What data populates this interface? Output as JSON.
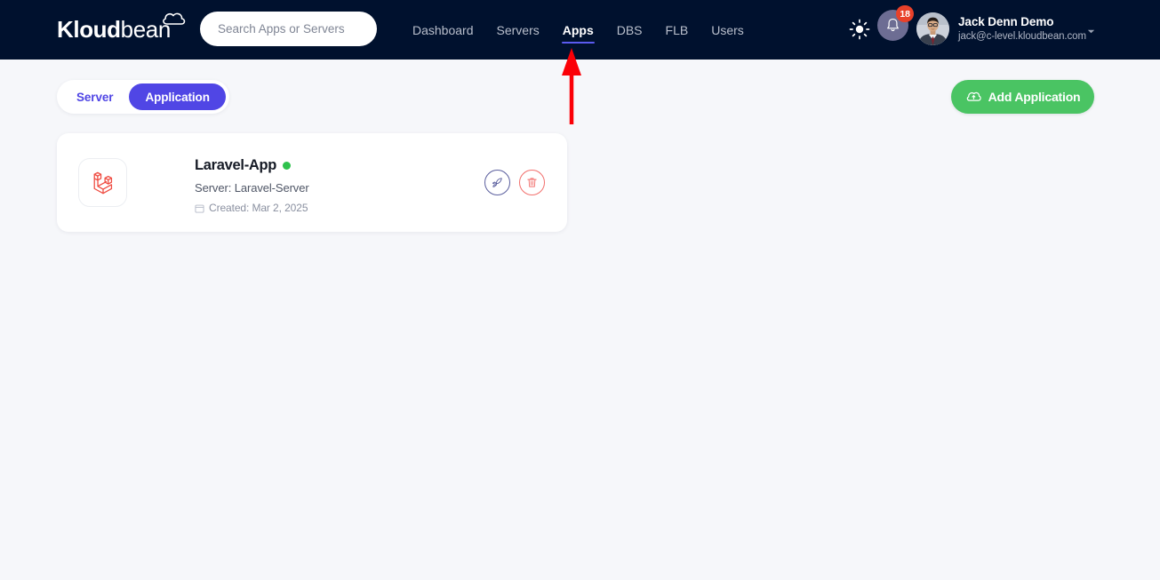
{
  "header": {
    "logo": {
      "bold": "Kloud",
      "light": "bean",
      "cloud_icon": "cloud-icon"
    },
    "search": {
      "placeholder": "Search Apps or Servers",
      "value": "",
      "icon": "search-input"
    },
    "nav": [
      {
        "label": "Dashboard",
        "active": false
      },
      {
        "label": "Servers",
        "active": false
      },
      {
        "label": "Apps",
        "active": true
      },
      {
        "label": "DBS",
        "active": false
      },
      {
        "label": "FLB",
        "active": false
      },
      {
        "label": "Users",
        "active": false
      }
    ],
    "theme_toggle_icon": "sun-icon",
    "notifications": {
      "icon": "bell-icon",
      "count": "18",
      "badge_color": "#e8412a",
      "circle_color": "#6d6d93"
    },
    "user": {
      "avatar_icon": "user-avatar",
      "name": "Jack Denn Demo",
      "email": "jack@c-level.kloudbean.com",
      "caret_icon": "chevron-down-icon"
    },
    "background_color": "#00112e",
    "active_underline_color": "#5b5bf0"
  },
  "controls": {
    "toggle": {
      "options": [
        {
          "label": "Server",
          "active": false
        },
        {
          "label": "Application",
          "active": true
        }
      ],
      "active_color": "#5046e5"
    },
    "add_application": {
      "label": "Add Application",
      "icon": "cloud-upload-icon",
      "color": "#4ac463"
    }
  },
  "applications": [
    {
      "icon": "laravel-icon",
      "name": "Laravel-App",
      "status": "online",
      "status_color": "#2fc24d",
      "server_label": "Server: Laravel-Server",
      "created_icon": "calendar-icon",
      "created_label": "Created: Mar 2, 2025",
      "actions": [
        {
          "name": "deploy-button",
          "icon": "rocket-icon",
          "color": "#5b5f9e"
        },
        {
          "name": "delete-button",
          "icon": "trash-icon",
          "color": "#f2706d"
        }
      ]
    }
  ],
  "annotation": {
    "type": "arrow-up",
    "color": "#fb0007",
    "points_to": "Apps"
  },
  "page": {
    "background_color": "#f6f7fa"
  }
}
